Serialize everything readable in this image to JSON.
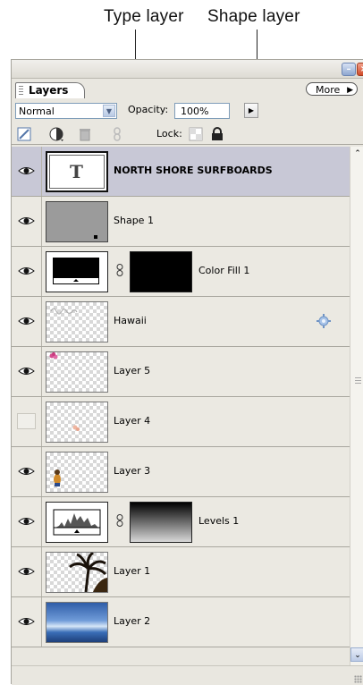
{
  "callouts": {
    "type_layer": "Type layer",
    "shape_layer": "Shape layer"
  },
  "panel": {
    "tab_label": "Layers",
    "more_label": "More",
    "blend_mode": "Normal",
    "opacity_label": "Opacity:",
    "opacity_value": "100%",
    "lock_label": "Lock:"
  },
  "layers": [
    {
      "name": "NORTH SHORE SURFBOARDS",
      "visible": true,
      "selected": true,
      "kind": "type"
    },
    {
      "name": "Shape 1",
      "visible": true,
      "kind": "shape"
    },
    {
      "name": "Color Fill 1",
      "visible": true,
      "kind": "fill"
    },
    {
      "name": "Hawaii",
      "visible": true,
      "kind": "pixel",
      "has_effect_icon": true
    },
    {
      "name": "Layer 5",
      "visible": true,
      "kind": "pixel"
    },
    {
      "name": "Layer 4",
      "visible": false,
      "kind": "pixel"
    },
    {
      "name": "Layer 3",
      "visible": true,
      "kind": "pixel"
    },
    {
      "name": "Levels 1",
      "visible": true,
      "kind": "adjustment"
    },
    {
      "name": "Layer 1",
      "visible": true,
      "kind": "pixel"
    },
    {
      "name": "Layer 2",
      "visible": true,
      "kind": "pixel"
    }
  ],
  "colors": {
    "selected_row": "#c8c8d6",
    "panel_bg": "#e9e7e0"
  }
}
